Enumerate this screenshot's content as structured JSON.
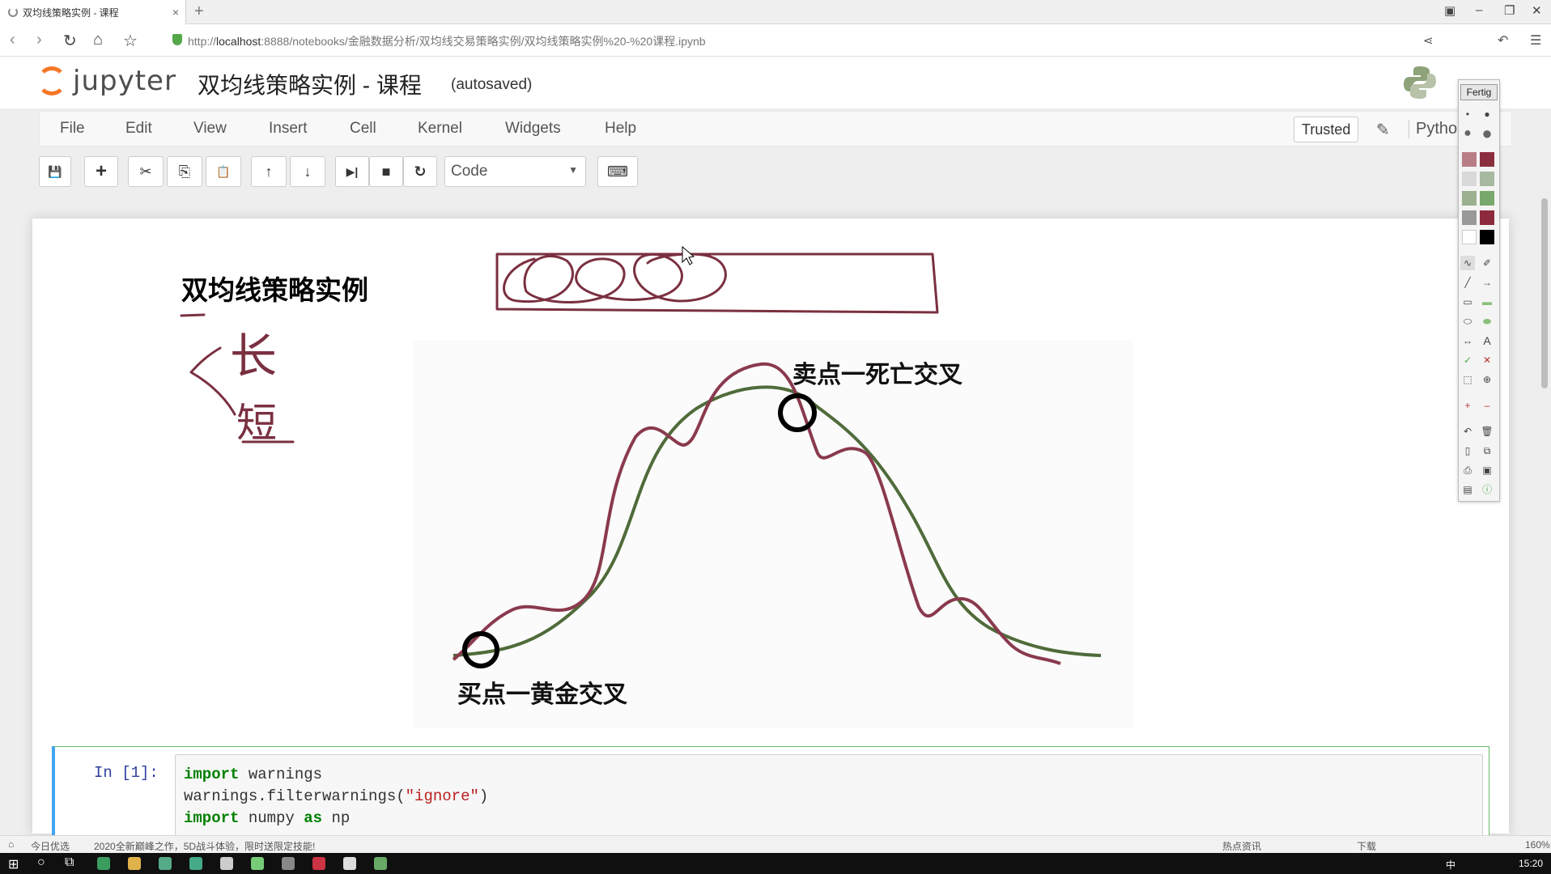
{
  "browser": {
    "tab_title": "双均线策略实例 - 课程",
    "tab_close": "×",
    "new_tab": "+",
    "url_prefix": "http://",
    "url_host": "localhost",
    "url_rest": ":8888/notebooks/金融数据分析/双均线交易策略实例/双均线策略实例%20-%20课程.ipynb",
    "nav": {
      "back": "‹",
      "forward": "›",
      "reload": "↻",
      "home": "⌂",
      "star": "☆"
    },
    "window_controls": [
      "–",
      "❐",
      "✕"
    ]
  },
  "jupyter": {
    "logo_text": "jupyter",
    "notebook_title": "双均线策略实例 - 课程",
    "autosave": "(autosaved)",
    "menu": [
      "File",
      "Edit",
      "View",
      "Insert",
      "Cell",
      "Kernel",
      "Widgets",
      "Help"
    ],
    "trusted": "Trusted",
    "kernel_name": "Pytho",
    "toolbar": {
      "save": "💾",
      "add": "+",
      "cut": "✂",
      "copy": "⎘",
      "paste": "📋",
      "up": "↑",
      "down": "↓",
      "run": "▶|",
      "stop": "■",
      "restart": "↻",
      "keyboard": "⌨"
    },
    "cell_type": "Code",
    "cell_type_caret": "▼"
  },
  "notebook": {
    "markdown_title": "双均线策略实例",
    "figure": {
      "sell_label": "卖点一死亡交叉",
      "buy_label": "买点一黄金交叉"
    },
    "handwriting": {
      "long": "长",
      "short": "短"
    },
    "code_cell": {
      "prompt": "In [1]:",
      "lines": [
        {
          "kw": "import",
          "rest": " warnings"
        },
        {
          "plain": "warnings.filterwarnings(",
          "str": "\"ignore\"",
          "end": ")"
        },
        {
          "kw": "import",
          "rest": " numpy ",
          "kw2": "as",
          "rest2": " np"
        }
      ]
    }
  },
  "palette": {
    "title": "Fertig"
  },
  "status": {
    "left_items": [
      "今日优选",
      "2020全新巅峰之作，5D战斗体验，限时送限定技能!"
    ],
    "right_items": [
      "热点资讯",
      "下载",
      "160%"
    ],
    "clock": "15:20",
    "ime": "中"
  },
  "colors": {
    "jupyter_orange": "#f37726",
    "ink": "#7a3040",
    "ma_long": "#4f6b3a",
    "ma_short": "#8a3a4e",
    "cell_border": "#66bb6a"
  }
}
